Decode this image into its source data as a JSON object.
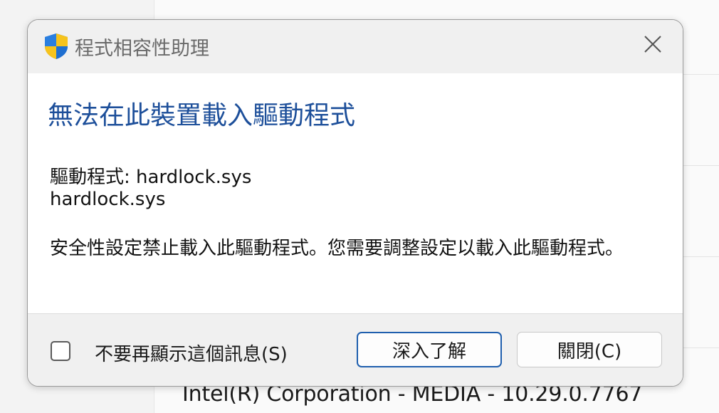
{
  "background": {
    "status_text": "Intel(R) Corporation - MEDIA - 10.29.0.7767"
  },
  "dialog": {
    "title": "程式相容性助理",
    "title_icon": "uac-shield-icon",
    "close_icon": "close-icon",
    "heading": "無法在此裝置載入驅動程式",
    "driver_line": "驅動程式: hardlock.sys",
    "driver_file": "hardlock.sys",
    "description": "安全性設定禁止載入此驅動程式。您需要調整設定以載入此驅動程式。",
    "checkbox_label": "不要再顯示這個訊息(S)",
    "checkbox_checked": false,
    "learn_more_label": "深入了解",
    "close_label": "關閉(C)"
  },
  "colors": {
    "heading": "#1d4f9a",
    "accent_border": "#1f5fae",
    "shield_blue": "#1f6fd0",
    "shield_yellow": "#f6c31c"
  }
}
